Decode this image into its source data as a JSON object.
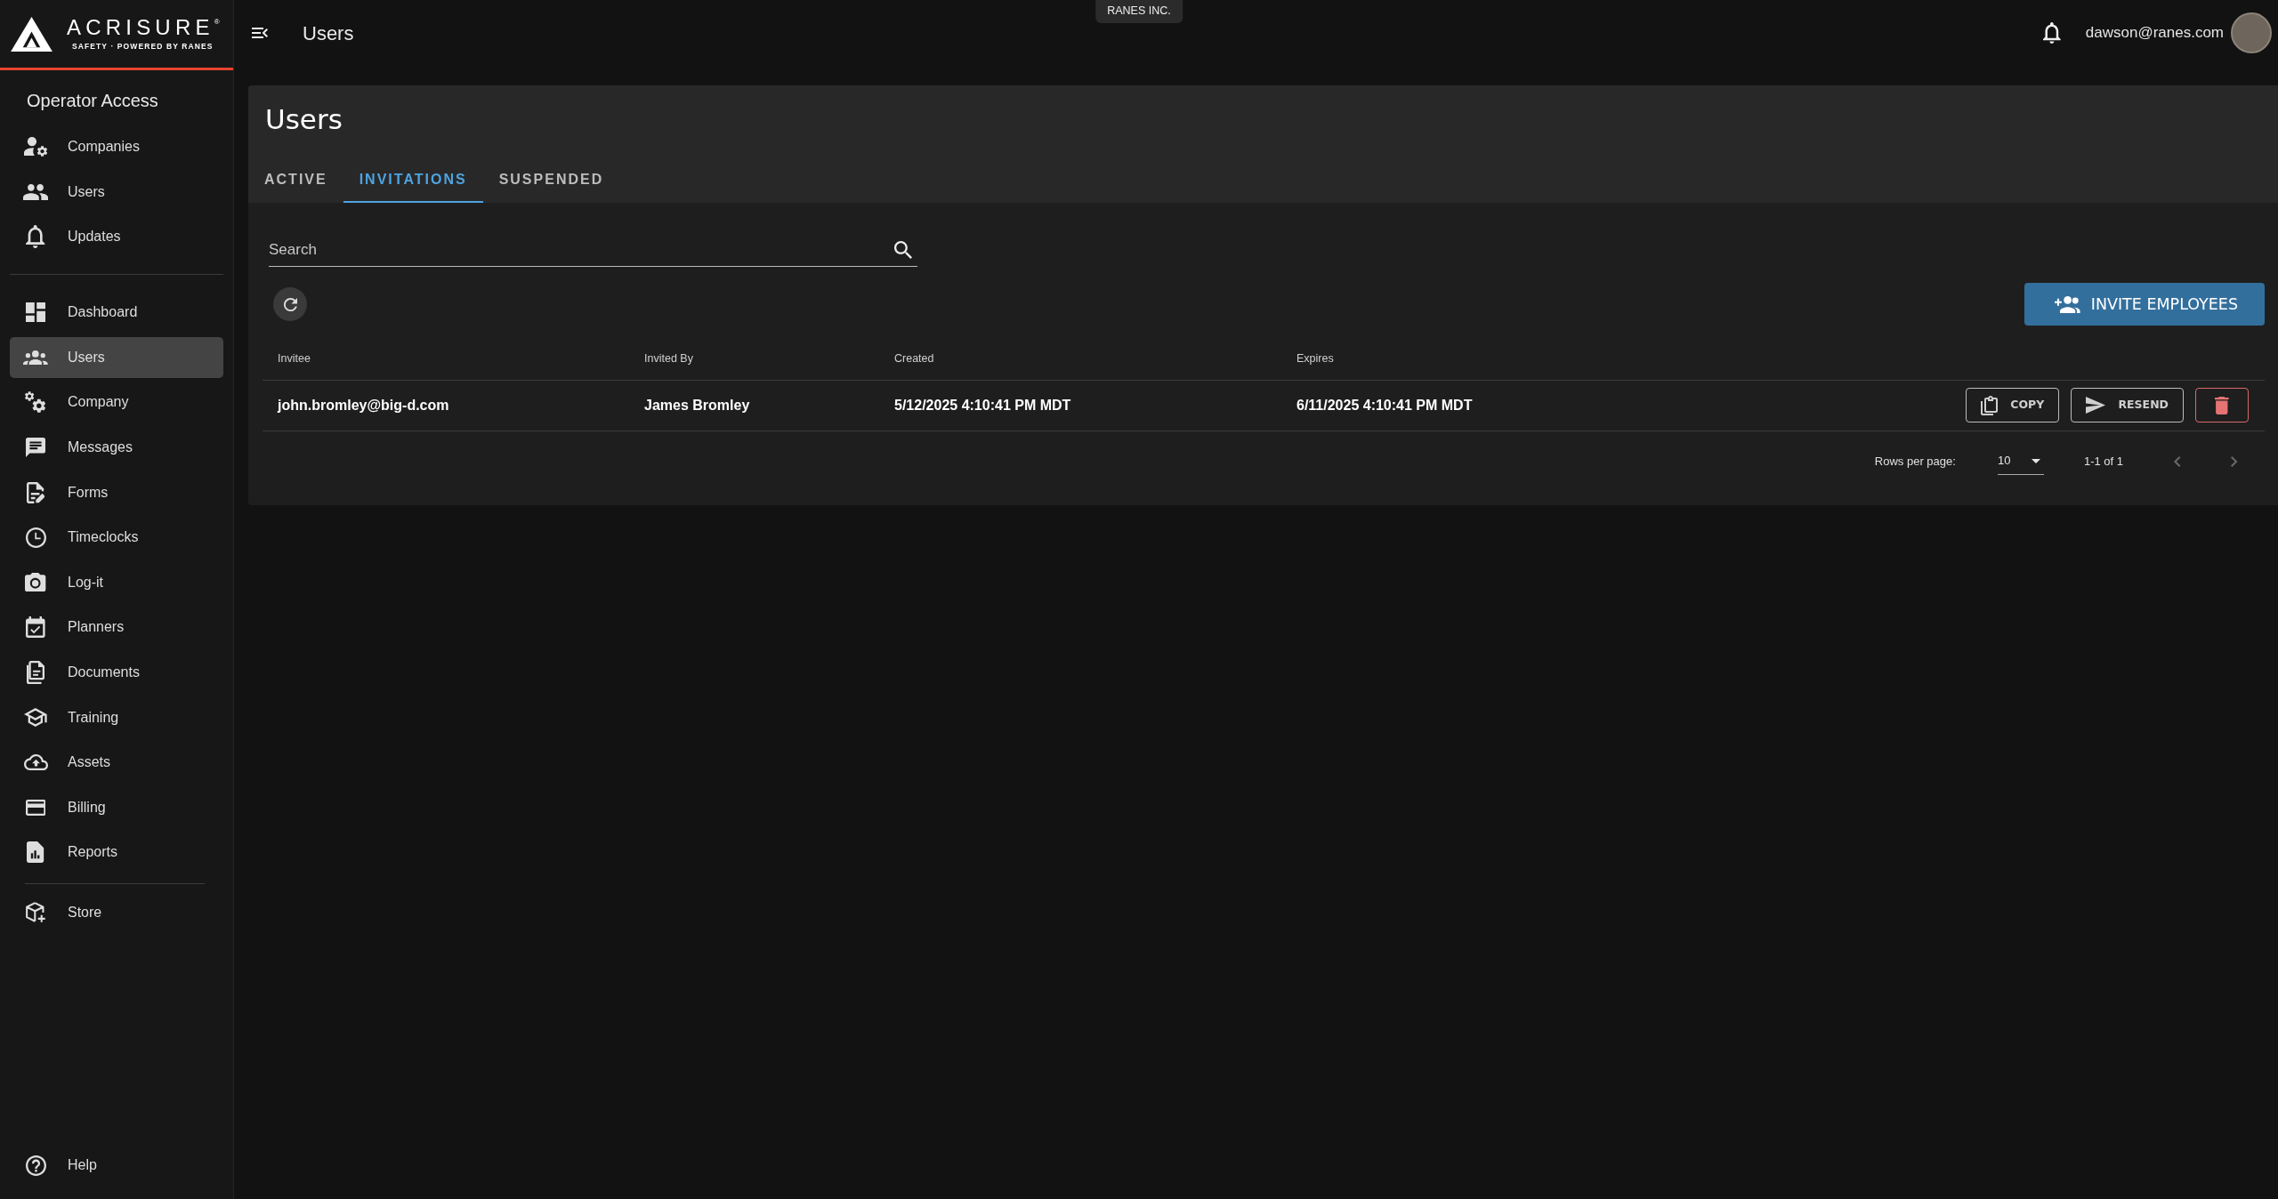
{
  "brand": {
    "name": "ACRISURE$^{®}$",
    "tagline": "SAFETY · POWERED BY RANES"
  },
  "sidebar": {
    "section_title": "Operator Access",
    "operator_items": [
      {
        "label": "Companies",
        "selected": false
      },
      {
        "label": "Users",
        "selected": false
      },
      {
        "label": "Updates",
        "selected": false
      }
    ],
    "main_items": [
      {
        "label": "Dashboard",
        "selected": false
      },
      {
        "label": "Users",
        "selected": true
      },
      {
        "label": "Company",
        "selected": false
      },
      {
        "label": "Messages",
        "selected": false
      },
      {
        "label": "Forms",
        "selected": false
      },
      {
        "label": "Timeclocks",
        "selected": false
      },
      {
        "label": "Log-it",
        "selected": false
      },
      {
        "label": "Planners",
        "selected": false
      },
      {
        "label": "Documents",
        "selected": false
      },
      {
        "label": "Training",
        "selected": false
      },
      {
        "label": "Assets",
        "selected": false
      },
      {
        "label": "Billing",
        "selected": false
      },
      {
        "label": "Reports",
        "selected": false
      }
    ],
    "store_items": [
      {
        "label": "Store",
        "selected": false
      }
    ],
    "footer_items": [
      {
        "label": "Help",
        "selected": false
      }
    ]
  },
  "top_bar": {
    "title": "Users",
    "organization": "RANES INC.",
    "user_email": "dawson@ranes.com"
  },
  "page": {
    "title": "Users",
    "tabs": [
      {
        "label": "ACTIVE",
        "selected": false
      },
      {
        "label": "INVITATIONS",
        "selected": true
      },
      {
        "label": "SUSPENDED",
        "selected": false
      }
    ],
    "search": {
      "placeholder": "Search"
    },
    "invite_button": "INVITE EMPLOYEES",
    "table": {
      "columns": [
        "Invitee",
        "Invited By",
        "Created",
        "Expires"
      ],
      "rows": [
        {
          "cells": [
            "john.bromley@big-d.com",
            "James Bromley",
            "5/12/2025 4:10:41 PM MDT",
            "6/11/2025 4:10:41 PM MDT"
          ],
          "actions": [
            {
              "kind": "copy",
              "label": "COPY"
            },
            {
              "kind": "resend",
              "label": "RESEND"
            },
            {
              "kind": "delete"
            }
          ]
        }
      ]
    },
    "pagination": {
      "rows_per_page_label": "Rows per page:",
      "rows_per_page": "10",
      "range": "1-1 of 1",
      "previous": {
        "disabled": true
      },
      "next": {
        "disabled": true
      }
    }
  }
}
